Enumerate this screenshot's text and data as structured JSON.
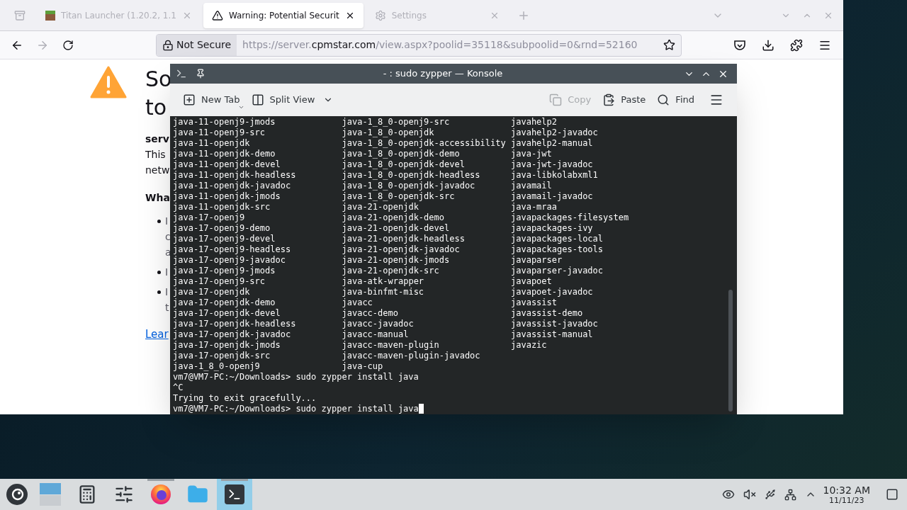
{
  "browser": {
    "tabs": [
      {
        "kind": "game",
        "title": "Titan Launcher (1.20.2, 1.1",
        "selected": false
      },
      {
        "kind": "warning",
        "title": "Warning: Potential Securit",
        "selected": true
      },
      {
        "kind": "settings",
        "title": "Settings",
        "selected": false
      }
    ],
    "address": {
      "security": "Not Secure",
      "url_prefix": "https://server.",
      "url_domain": "cpmstar.com",
      "url_rest": "/view.aspx?poolid=35118&subpoolid=0&rnd=52160"
    },
    "page": {
      "heading_lines": [
        "So",
        "to"
      ],
      "site_fragment": "serv",
      "para_lines": [
        "This",
        "netw"
      ],
      "subheading": "Wha",
      "bullets": [
        {
          "lines": [
            "I",
            "c",
            "a"
          ]
        },
        {
          "lines": [
            "I"
          ]
        },
        {
          "lines": [
            "I",
            "t"
          ]
        }
      ],
      "link": "Lear"
    }
  },
  "konsole": {
    "title": "- : sudo zypper — Konsole",
    "toolbar": [
      {
        "kind": "new-tab",
        "label": "New Tab",
        "disabled": false
      },
      {
        "kind": "split",
        "label": "Split View",
        "disabled": false
      },
      {
        "kind": "copy",
        "label": "Copy",
        "disabled": true
      },
      {
        "kind": "paste",
        "label": "Paste",
        "disabled": false
      },
      {
        "kind": "find",
        "label": "Find",
        "disabled": false
      }
    ],
    "columns": [
      [
        "java-11-openj9-jmods",
        "java-11-openj9-src",
        "java-11-openjdk",
        "java-11-openjdk-demo",
        "java-11-openjdk-devel",
        "java-11-openjdk-headless",
        "java-11-openjdk-javadoc",
        "java-11-openjdk-jmods",
        "java-11-openjdk-src",
        "java-17-openj9",
        "java-17-openj9-demo",
        "java-17-openj9-devel",
        "java-17-openj9-headless",
        "java-17-openj9-javadoc",
        "java-17-openj9-jmods",
        "java-17-openj9-src",
        "java-17-openjdk",
        "java-17-openjdk-demo",
        "java-17-openjdk-devel",
        "java-17-openjdk-headless",
        "java-17-openjdk-javadoc",
        "java-17-openjdk-jmods",
        "java-17-openjdk-src",
        "java-1_8_0-openj9"
      ],
      [
        "java-1_8_0-openj9-src",
        "java-1_8_0-openjdk",
        "java-1_8_0-openjdk-accessibility",
        "java-1_8_0-openjdk-demo",
        "java-1_8_0-openjdk-devel",
        "java-1_8_0-openjdk-headless",
        "java-1_8_0-openjdk-javadoc",
        "java-1_8_0-openjdk-src",
        "java-21-openjdk",
        "java-21-openjdk-demo",
        "java-21-openjdk-devel",
        "java-21-openjdk-headless",
        "java-21-openjdk-javadoc",
        "java-21-openjdk-jmods",
        "java-21-openjdk-src",
        "java-atk-wrapper",
        "java-binfmt-misc",
        "javacc",
        "javacc-demo",
        "javacc-javadoc",
        "javacc-manual",
        "javacc-maven-plugin",
        "javacc-maven-plugin-javadoc",
        "java-cup"
      ],
      [
        "javahelp2",
        "javahelp2-javadoc",
        "javahelp2-manual",
        "java-jwt",
        "java-jwt-javadoc",
        "java-libkolabxml1",
        "javamail",
        "javamail-javadoc",
        "java-mraa",
        "javapackages-filesystem",
        "javapackages-ivy",
        "javapackages-local",
        "javapackages-tools",
        "javaparser",
        "javaparser-javadoc",
        "javapoet",
        "javapoet-javadoc",
        "javassist",
        "javassist-demo",
        "javassist-javadoc",
        "javassist-manual",
        "javazic"
      ]
    ],
    "lines": [
      "vm7@VM7-PC:~/Downloads> sudo zypper install java",
      "^C",
      "Trying to exit gracefully...",
      "vm7@VM7-PC:~/Downloads> sudo zypper install java"
    ]
  },
  "taskbar": {
    "apps": [
      {
        "kind": "pager",
        "open": false,
        "selected": false
      },
      {
        "kind": "calculator",
        "open": false,
        "selected": false
      },
      {
        "kind": "settings",
        "open": false,
        "selected": false
      },
      {
        "kind": "firefox",
        "open": true,
        "selected": false
      },
      {
        "kind": "files",
        "open": false,
        "selected": false
      },
      {
        "kind": "terminal",
        "open": true,
        "selected": true
      }
    ],
    "time": "10:32 AM",
    "date": "11/11/23"
  }
}
